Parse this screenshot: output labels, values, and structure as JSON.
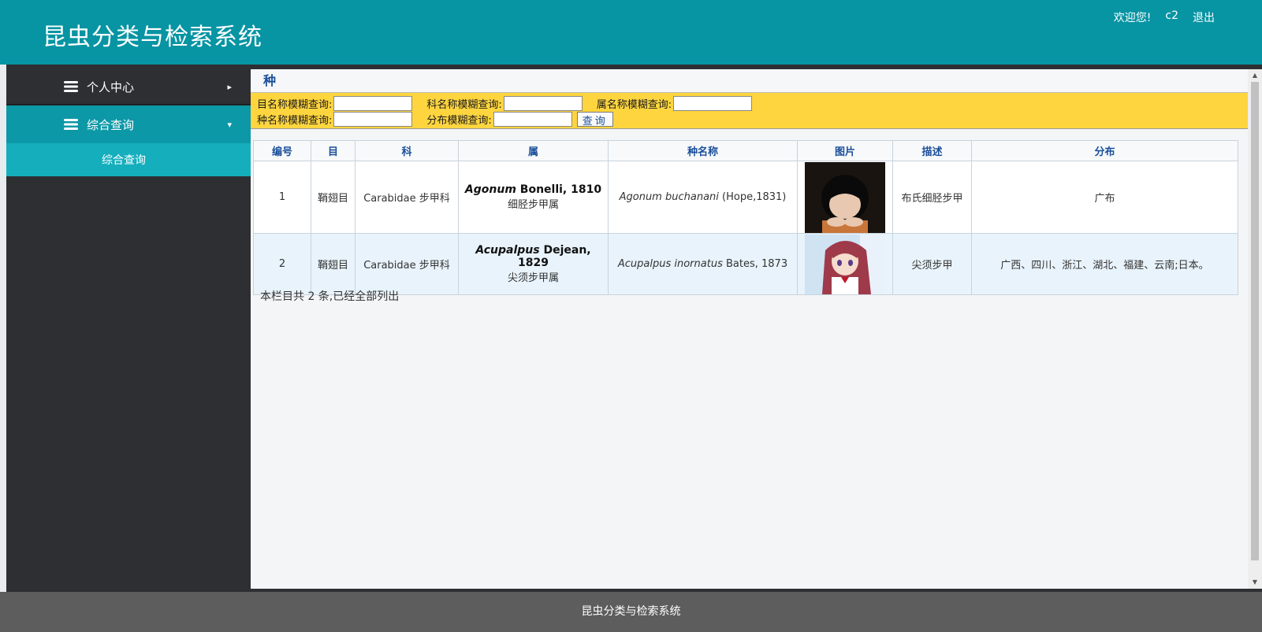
{
  "header": {
    "title": "昆虫分类与检索系统",
    "welcome": "欢迎您!",
    "username": "c2",
    "logout": "退出"
  },
  "sidebar": {
    "items": [
      {
        "label": "个人中心",
        "icon": "layers-icon",
        "arrow": "▸"
      },
      {
        "label": "综合查询",
        "icon": "layers-icon",
        "arrow": "▾"
      }
    ],
    "submenu": [
      {
        "label": "综合查询"
      }
    ]
  },
  "main": {
    "section_title": "种",
    "search": {
      "order_label": "目名称模糊查询:",
      "family_label": "科名称模糊查询:",
      "genus_label": "属名称模糊查询:",
      "species_label": "种名称模糊查询:",
      "distribution_label": "分布模糊查询:",
      "order_value": "",
      "family_value": "",
      "genus_value": "",
      "species_value": "",
      "distribution_value": "",
      "button": "查询"
    },
    "table": {
      "headers": [
        "编号",
        "目",
        "科",
        "属",
        "种名称",
        "图片",
        "描述",
        "分布"
      ],
      "rows": [
        {
          "id": "1",
          "order": "鞘翅目",
          "family": "Carabidae 步甲科",
          "genus_latin": "Agonum",
          "genus_author": "Bonelli, 1810",
          "genus_cn": "细胫步甲属",
          "species_latin": "Agonum buchanani",
          "species_author": "(Hope,1831)",
          "image": "dark-haired-boy-image",
          "description": "布氏细胫步甲",
          "distribution": "广布"
        },
        {
          "id": "2",
          "order": "鞘翅目",
          "family": "Carabidae 步甲科",
          "genus_latin": "Acupalpus",
          "genus_author": "Dejean, 1829",
          "genus_cn": "尖须步甲属",
          "species_latin": "Acupalpus inornatus",
          "species_author": "Bates, 1873",
          "image": "red-haired-girl-image",
          "description": "尖须步甲",
          "distribution": "广西、四川、浙江、湖北、福建、云南;日本。"
        }
      ]
    },
    "count_note": "本栏目共 2 条,已经全部列出"
  },
  "footer": {
    "text": "昆虫分类与检索系统"
  },
  "colors": {
    "header_bg": "#0794a3",
    "sidebar_bg": "#2d2f33",
    "active_menu": "#0d98a7",
    "submenu": "#14aebd",
    "search_bar": "#fed53f",
    "footer_bg": "#5d5d5d"
  }
}
